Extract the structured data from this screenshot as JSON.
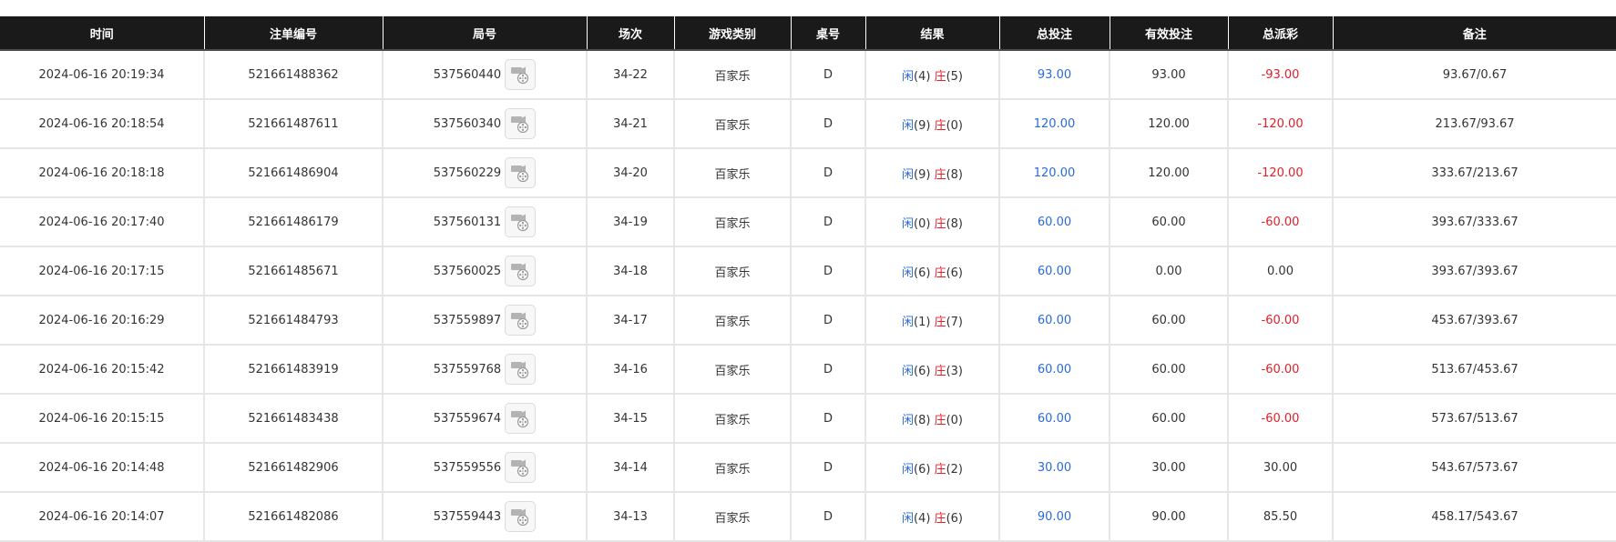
{
  "headers": [
    "时间",
    "注单编号",
    "局号",
    "场次",
    "游戏类别",
    "桌号",
    "结果",
    "总投注",
    "有效投注",
    "总派彩",
    "备注"
  ],
  "colors": {
    "header_bg": "#1a1a1a",
    "blue": "#2a6ad9",
    "red": "#e0202a",
    "grid": "#e6e6e6"
  },
  "icons": {
    "replay": "video-camera-replay-icon"
  },
  "rows": [
    {
      "time": "2024-06-16 20:19:34",
      "bet_id": "521661488362",
      "round": "537560440",
      "session": "34-22",
      "game": "百家乐",
      "table": "D",
      "player_label": "闲",
      "player_score": "(4)",
      "banker_label": "庄",
      "banker_score": "(5)",
      "total_bet": "93.00",
      "valid_bet": "93.00",
      "payout": "-93.00",
      "payout_neg": true,
      "remark": "93.67/0.67"
    },
    {
      "time": "2024-06-16 20:18:54",
      "bet_id": "521661487611",
      "round": "537560340",
      "session": "34-21",
      "game": "百家乐",
      "table": "D",
      "player_label": "闲",
      "player_score": "(9)",
      "banker_label": "庄",
      "banker_score": "(0)",
      "total_bet": "120.00",
      "valid_bet": "120.00",
      "payout": "-120.00",
      "payout_neg": true,
      "remark": "213.67/93.67"
    },
    {
      "time": "2024-06-16 20:18:18",
      "bet_id": "521661486904",
      "round": "537560229",
      "session": "34-20",
      "game": "百家乐",
      "table": "D",
      "player_label": "闲",
      "player_score": "(9)",
      "banker_label": "庄",
      "banker_score": "(8)",
      "total_bet": "120.00",
      "valid_bet": "120.00",
      "payout": "-120.00",
      "payout_neg": true,
      "remark": "333.67/213.67"
    },
    {
      "time": "2024-06-16 20:17:40",
      "bet_id": "521661486179",
      "round": "537560131",
      "session": "34-19",
      "game": "百家乐",
      "table": "D",
      "player_label": "闲",
      "player_score": "(0)",
      "banker_label": "庄",
      "banker_score": "(8)",
      "total_bet": "60.00",
      "valid_bet": "60.00",
      "payout": "-60.00",
      "payout_neg": true,
      "remark": "393.67/333.67"
    },
    {
      "time": "2024-06-16 20:17:15",
      "bet_id": "521661485671",
      "round": "537560025",
      "session": "34-18",
      "game": "百家乐",
      "table": "D",
      "player_label": "闲",
      "player_score": "(6)",
      "banker_label": "庄",
      "banker_score": "(6)",
      "total_bet": "60.00",
      "valid_bet": "0.00",
      "payout": "0.00",
      "payout_neg": false,
      "remark": "393.67/393.67"
    },
    {
      "time": "2024-06-16 20:16:29",
      "bet_id": "521661484793",
      "round": "537559897",
      "session": "34-17",
      "game": "百家乐",
      "table": "D",
      "player_label": "闲",
      "player_score": "(1)",
      "banker_label": "庄",
      "banker_score": "(7)",
      "total_bet": "60.00",
      "valid_bet": "60.00",
      "payout": "-60.00",
      "payout_neg": true,
      "remark": "453.67/393.67"
    },
    {
      "time": "2024-06-16 20:15:42",
      "bet_id": "521661483919",
      "round": "537559768",
      "session": "34-16",
      "game": "百家乐",
      "table": "D",
      "player_label": "闲",
      "player_score": "(6)",
      "banker_label": "庄",
      "banker_score": "(3)",
      "total_bet": "60.00",
      "valid_bet": "60.00",
      "payout": "-60.00",
      "payout_neg": true,
      "remark": "513.67/453.67"
    },
    {
      "time": "2024-06-16 20:15:15",
      "bet_id": "521661483438",
      "round": "537559674",
      "session": "34-15",
      "game": "百家乐",
      "table": "D",
      "player_label": "闲",
      "player_score": "(8)",
      "banker_label": "庄",
      "banker_score": "(0)",
      "total_bet": "60.00",
      "valid_bet": "60.00",
      "payout": "-60.00",
      "payout_neg": true,
      "remark": "573.67/513.67"
    },
    {
      "time": "2024-06-16 20:14:48",
      "bet_id": "521661482906",
      "round": "537559556",
      "session": "34-14",
      "game": "百家乐",
      "table": "D",
      "player_label": "闲",
      "player_score": "(6)",
      "banker_label": "庄",
      "banker_score": "(2)",
      "total_bet": "30.00",
      "valid_bet": "30.00",
      "payout": "30.00",
      "payout_neg": false,
      "remark": "543.67/573.67"
    },
    {
      "time": "2024-06-16 20:14:07",
      "bet_id": "521661482086",
      "round": "537559443",
      "session": "34-13",
      "game": "百家乐",
      "table": "D",
      "player_label": "闲",
      "player_score": "(4)",
      "banker_label": "庄",
      "banker_score": "(6)",
      "total_bet": "90.00",
      "valid_bet": "90.00",
      "payout": "85.50",
      "payout_neg": false,
      "remark": "458.17/543.67"
    }
  ]
}
